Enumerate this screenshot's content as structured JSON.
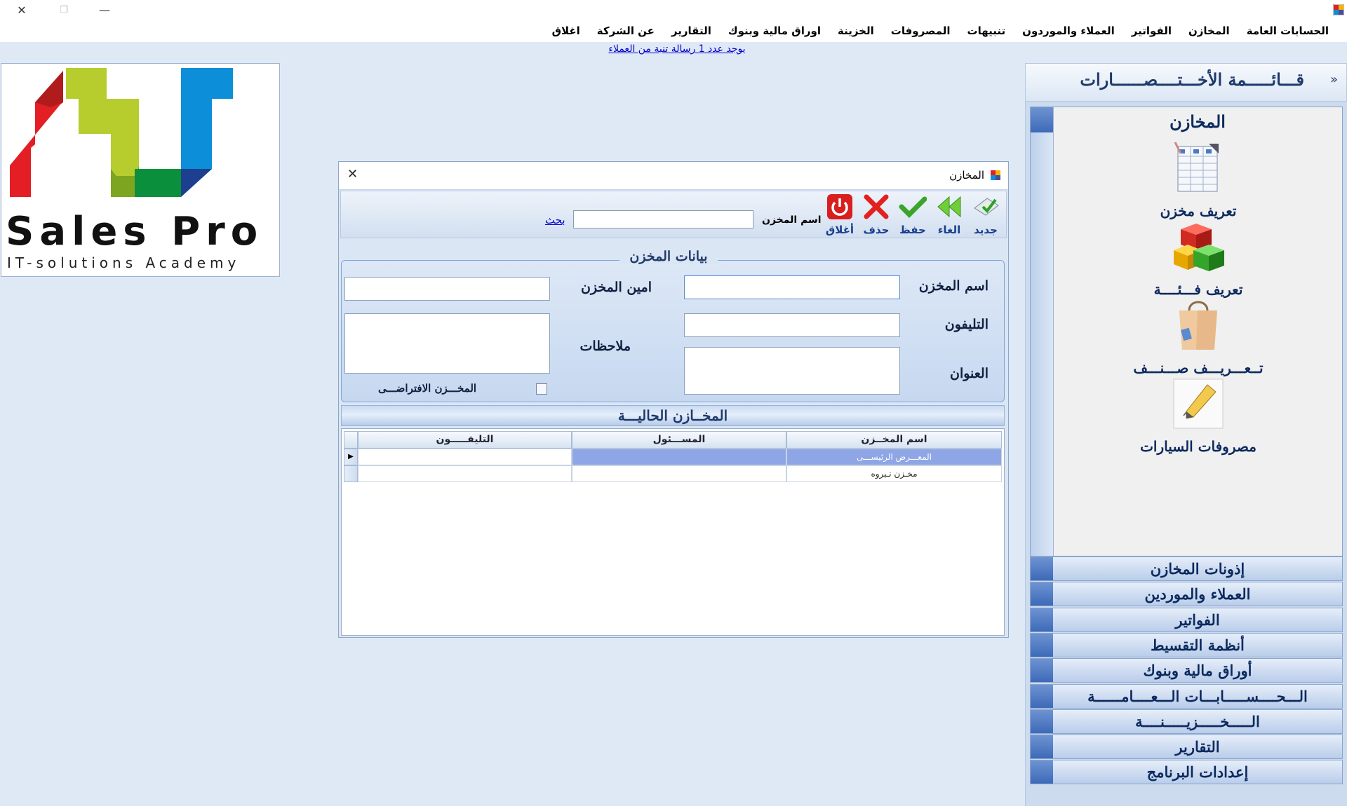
{
  "window": {
    "close_glyph": "✕",
    "maximize_glyph": "❐",
    "minimize_glyph": "—"
  },
  "menu": [
    "الحسابات العامة",
    "المخازن",
    "الفواتير",
    "العملاء والموردون",
    "تنبيهات",
    "المصروفات",
    "الخزينة",
    "اوراق مالية وبنوك",
    "التقارير",
    "عن الشركة",
    "اغلاق"
  ],
  "notice": "يوجد عدد  1 رسالة تنبة من العملاء ",
  "logo": {
    "title": "Sales Pro",
    "subtitle": "IT-solutions Academy",
    "colors": [
      "#e31e24",
      "#b7cd2e",
      "#0a8f3d",
      "#0c8fd8",
      "#1e3f8f"
    ]
  },
  "shortcuts": {
    "header": "قـــائـــــمة الأخـــتــــصــــــارات",
    "collapse_glyph": "»",
    "active_group": {
      "title": "المخازن",
      "items": [
        {
          "label": "تعريف مخزن",
          "icon": "spreadsheet-icon"
        },
        {
          "label": "تعريف فـــئــــة",
          "icon": "boxes-icon"
        },
        {
          "label": "تــعـــريـــف صـــنـــف",
          "icon": "shopping-bag-icon"
        },
        {
          "label": "مصروفات السيارات",
          "icon": "pencil-note-icon"
        }
      ]
    },
    "groups": [
      "إذونات المخازن",
      "العملاء والموردين",
      "الفواتير",
      "أنظمة التقسيط",
      "أوراق مالية وبنوك",
      "الـــحــــســـــابـــات الـــعــــامــــــة",
      "الـــــخـــــزيـــــنــــة",
      "التقارير",
      "إعدادات البرنامج"
    ]
  },
  "dialog": {
    "title": "المخازن",
    "close_glyph": "✕",
    "toolbar": {
      "new": "جديد",
      "undo": "الغاء",
      "save": "حفظ",
      "delete": "حذف",
      "close": "أغلاق",
      "search_label": "اسم المخزن",
      "search_value": "",
      "search_link": "بحث"
    },
    "form": {
      "legend": "بيانات المخزن",
      "store_name_label": "اسم المخزن",
      "store_name_value": "",
      "phone_label": "التليفون",
      "phone_value": "",
      "address_label": "العنوان",
      "address_value": "",
      "keeper_label": "امين المخزن",
      "keeper_value": "",
      "notes_label": "ملاحظات",
      "notes_value": "",
      "default_label": "المخـــزن الافتراضـــى",
      "default_checked": false
    },
    "grid": {
      "title": "المخــازن الحاليـــة",
      "columns": [
        "اسم المخــزن",
        "المســـئول",
        "التليفـــــون"
      ],
      "rows": [
        {
          "name": "المعـــرض الرئيســـى",
          "owner": "",
          "phone": "",
          "selected": true
        },
        {
          "name": "مخـزن نـبروه",
          "owner": "",
          "phone": "",
          "selected": false
        }
      ],
      "current_row_glyph": "▶"
    }
  },
  "colors": {
    "accent": "#3d6ab8",
    "link": "#0000cc",
    "panel_bg": "#dfe9f5",
    "selected_row": "#8ea6e6"
  }
}
